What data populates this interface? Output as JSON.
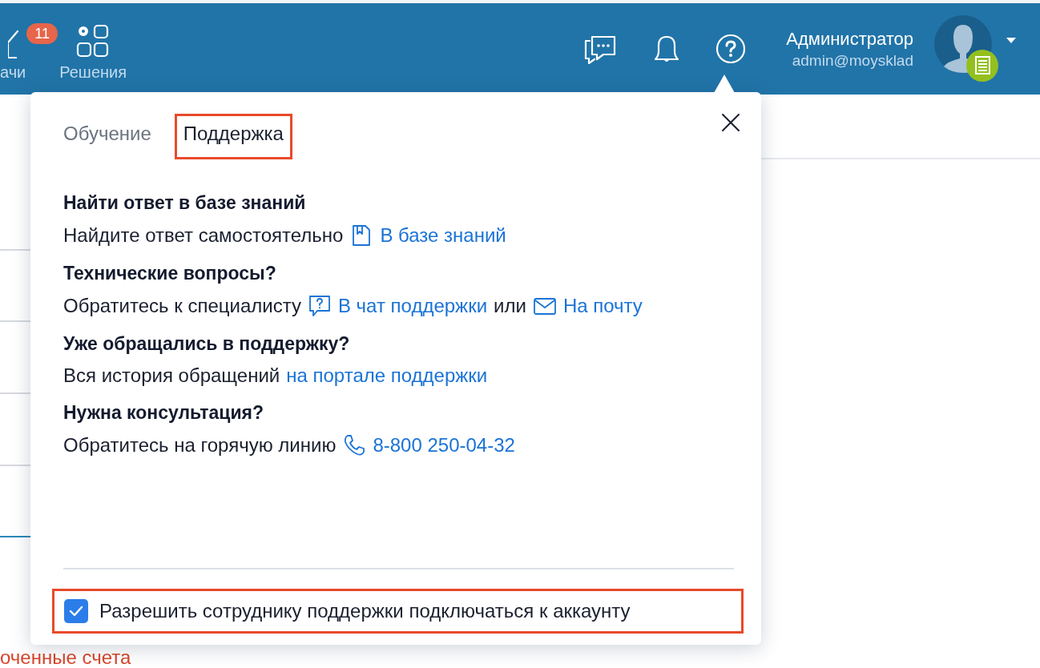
{
  "header": {
    "nav_items": [
      {
        "kind": "tasks",
        "label": "ачи",
        "badge": "11"
      },
      {
        "kind": "solutions",
        "label": "Решения"
      }
    ],
    "user": {
      "name": "Администратор",
      "email": "admin@moysklad"
    }
  },
  "page": {
    "footer_text": "оченные счета"
  },
  "popup": {
    "tabs": [
      {
        "label": "Обучение",
        "selected": false,
        "highlighted": false
      },
      {
        "label": "Поддержка",
        "selected": true,
        "highlighted": true
      }
    ],
    "sections": [
      {
        "title": "Найти ответ в базе знаний",
        "parts": [
          {
            "kind": "text",
            "text": "Найдите ответ самостоятельно"
          },
          {
            "kind": "book-link",
            "text": "В базе знаний"
          }
        ]
      },
      {
        "title": "Технические вопросы?",
        "parts": [
          {
            "kind": "text",
            "text": "Обратитесь к специалисту"
          },
          {
            "kind": "chat-link",
            "text": "В чат поддержки"
          },
          {
            "kind": "text",
            "text": "или"
          },
          {
            "kind": "mail-link",
            "text": "На почту"
          }
        ]
      },
      {
        "title": "Уже обращались в поддержку?",
        "parts": [
          {
            "kind": "text",
            "text": "Вся история обращений"
          },
          {
            "kind": "link",
            "text": "на портале поддержки"
          }
        ]
      },
      {
        "title": "Нужна консультация?",
        "parts": [
          {
            "kind": "text",
            "text": "Обратитесь на горячую линию"
          },
          {
            "kind": "phone-link",
            "text": "8-800 250-04-32"
          }
        ]
      }
    ],
    "consent": {
      "label": "Разрешить сотруднику поддержки подключаться к аккаунту",
      "checked": true,
      "highlighted": true
    }
  }
}
